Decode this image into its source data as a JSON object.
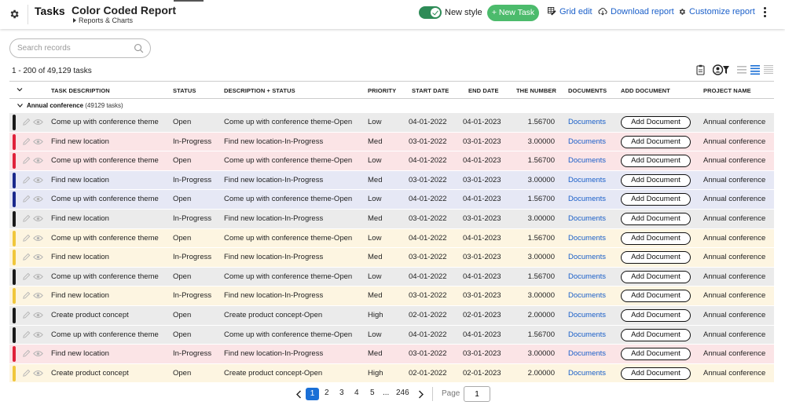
{
  "header": {
    "app_title": "Tasks",
    "breadcrumb_sep": "›",
    "report_title": "Color Coded Report",
    "sub_breadcrumb": "Reports & Charts",
    "new_style_label": "New style",
    "new_style_on": true,
    "new_task_label": "+ New Task",
    "grid_edit_label": "Grid edit",
    "download_label": "Download report",
    "customize_label": "Customize report"
  },
  "search": {
    "placeholder": "Search records"
  },
  "record_count": "1 - 200 of 49,129 tasks",
  "columns": [
    "TASK DESCRIPTION",
    "STATUS",
    "DESCRIPTION + STATUS",
    "PRIORITY",
    "START DATE",
    "END DATE",
    "THE NUMBER",
    "DOCUMENTS",
    "ADD DOCUMENT",
    "PROJECT NAME"
  ],
  "group": {
    "name": "Annual conference",
    "count": "(49129 tasks)"
  },
  "colors": {
    "black": "#1a1a1a",
    "red": "#e0223a",
    "navy": "#1b2a8c",
    "yellow": "#f0c73c",
    "bg_gray": "#ebebeb",
    "bg_pink": "#fbe4e6",
    "bg_blue": "#e6e8f5",
    "bg_yellow": "#fdf5e1",
    "accent_green": "#4cbb6c",
    "link_blue": "#1a5fc9"
  },
  "rows": [
    {
      "color": "black",
      "task": "Come up with conference theme",
      "status": "Open",
      "desc_status": "Come up with conference theme-Open",
      "priority": "Low",
      "start": "04-01-2022",
      "end": "04-01-2023",
      "number": "1.56700",
      "documents": "Documents",
      "add_doc": "Add Document",
      "project": "Annual conference"
    },
    {
      "color": "red",
      "task": "Find new location",
      "status": "In-Progress",
      "desc_status": "Find new location-In-Progress",
      "priority": "Med",
      "start": "03-01-2022",
      "end": "03-01-2023",
      "number": "3.00000",
      "documents": "Documents",
      "add_doc": "Add Document",
      "project": "Annual conference"
    },
    {
      "color": "red",
      "task": "Come up with conference theme",
      "status": "Open",
      "desc_status": "Come up with conference theme-Open",
      "priority": "Low",
      "start": "04-01-2022",
      "end": "04-01-2023",
      "number": "1.56700",
      "documents": "Documents",
      "add_doc": "Add Document",
      "project": "Annual conference"
    },
    {
      "color": "navy",
      "task": "Find new location",
      "status": "In-Progress",
      "desc_status": "Find new location-In-Progress",
      "priority": "Med",
      "start": "03-01-2022",
      "end": "03-01-2023",
      "number": "3.00000",
      "documents": "Documents",
      "add_doc": "Add Document",
      "project": "Annual conference"
    },
    {
      "color": "navy",
      "task": "Come up with conference theme",
      "status": "Open",
      "desc_status": "Come up with conference theme-Open",
      "priority": "Low",
      "start": "04-01-2022",
      "end": "04-01-2023",
      "number": "1.56700",
      "documents": "Documents",
      "add_doc": "Add Document",
      "project": "Annual conference"
    },
    {
      "color": "black",
      "task": "Find new location",
      "status": "In-Progress",
      "desc_status": "Find new location-In-Progress",
      "priority": "Med",
      "start": "03-01-2022",
      "end": "03-01-2023",
      "number": "3.00000",
      "documents": "Documents",
      "add_doc": "Add Document",
      "project": "Annual conference"
    },
    {
      "color": "yellow",
      "task": "Come up with conference theme",
      "status": "Open",
      "desc_status": "Come up with conference theme-Open",
      "priority": "Low",
      "start": "04-01-2022",
      "end": "04-01-2023",
      "number": "1.56700",
      "documents": "Documents",
      "add_doc": "Add Document",
      "project": "Annual conference"
    },
    {
      "color": "yellow",
      "task": "Find new location",
      "status": "In-Progress",
      "desc_status": "Find new location-In-Progress",
      "priority": "Med",
      "start": "03-01-2022",
      "end": "03-01-2023",
      "number": "3.00000",
      "documents": "Documents",
      "add_doc": "Add Document",
      "project": "Annual conference"
    },
    {
      "color": "black",
      "task": "Come up with conference theme",
      "status": "Open",
      "desc_status": "Come up with conference theme-Open",
      "priority": "Low",
      "start": "04-01-2022",
      "end": "04-01-2023",
      "number": "1.56700",
      "documents": "Documents",
      "add_doc": "Add Document",
      "project": "Annual conference"
    },
    {
      "color": "yellow",
      "task": "Find new location",
      "status": "In-Progress",
      "desc_status": "Find new location-In-Progress",
      "priority": "Med",
      "start": "03-01-2022",
      "end": "03-01-2023",
      "number": "3.00000",
      "documents": "Documents",
      "add_doc": "Add Document",
      "project": "Annual conference"
    },
    {
      "color": "black",
      "task": "Create product concept",
      "status": "Open",
      "desc_status": "Create product concept-Open",
      "priority": "High",
      "start": "02-01-2022",
      "end": "02-01-2023",
      "number": "2.00000",
      "documents": "Documents",
      "add_doc": "Add Document",
      "project": "Annual conference"
    },
    {
      "color": "black",
      "task": "Come up with conference theme",
      "status": "Open",
      "desc_status": "Come up with conference theme-Open",
      "priority": "Low",
      "start": "04-01-2022",
      "end": "04-01-2023",
      "number": "1.56700",
      "documents": "Documents",
      "add_doc": "Add Document",
      "project": "Annual conference"
    },
    {
      "color": "red",
      "task": "Find new location",
      "status": "In-Progress",
      "desc_status": "Find new location-In-Progress",
      "priority": "Med",
      "start": "03-01-2022",
      "end": "03-01-2023",
      "number": "3.00000",
      "documents": "Documents",
      "add_doc": "Add Document",
      "project": "Annual conference"
    },
    {
      "color": "yellow",
      "task": "Create product concept",
      "status": "Open",
      "desc_status": "Create product concept-Open",
      "priority": "High",
      "start": "02-01-2022",
      "end": "02-01-2023",
      "number": "2.00000",
      "documents": "Documents",
      "add_doc": "Add Document",
      "project": "Annual conference"
    }
  ],
  "pagination": {
    "pages": [
      "1",
      "2",
      "3",
      "4",
      "5"
    ],
    "ellipsis": "...",
    "last_page": "246",
    "current_page": "1",
    "page_label": "Page",
    "page_input_value": "1"
  }
}
